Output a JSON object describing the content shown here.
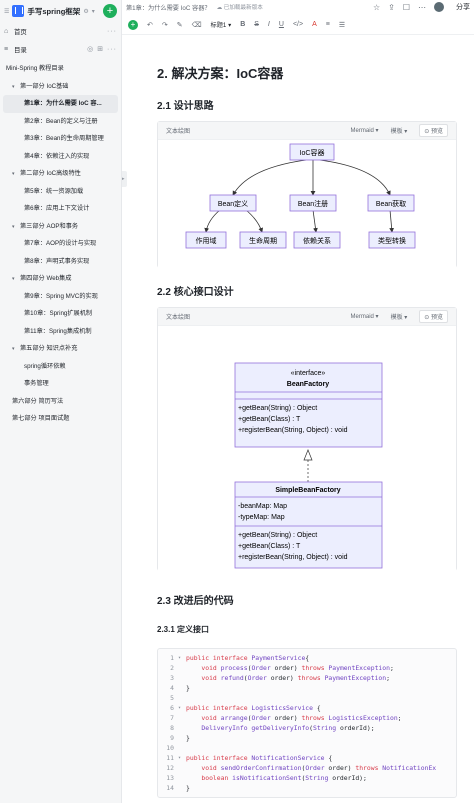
{
  "sidebar": {
    "book_title": "手写spring框架",
    "home_label": "首页",
    "toc_label": "目录",
    "tree": [
      {
        "label": "Mini-Spring 教程目录",
        "level": "l1"
      },
      {
        "label": "第一部分 IoC基础",
        "level": "l0",
        "arrow": true
      },
      {
        "label": "第1章：为什么需要 IoC 容...",
        "level": "l2",
        "active": true
      },
      {
        "label": "第2章：Bean的定义与注册",
        "level": "l2"
      },
      {
        "label": "第3章：Bean的生命周期管理",
        "level": "l2"
      },
      {
        "label": "第4章：依赖注入的实现",
        "level": "l2"
      },
      {
        "label": "第二部分 IoC高级特性",
        "level": "l0",
        "arrow": true
      },
      {
        "label": "第5章：统一资源加载",
        "level": "l2"
      },
      {
        "label": "第6章：应用上下文设计",
        "level": "l2"
      },
      {
        "label": "第三部分 AOP和事务",
        "level": "l0",
        "arrow": true
      },
      {
        "label": "第7章：AOP的设计与实现",
        "level": "l2"
      },
      {
        "label": "第8章：声明式事务实现",
        "level": "l2"
      },
      {
        "label": "第四部分 Web集成",
        "level": "l0",
        "arrow": true
      },
      {
        "label": "第9章：Spring MVC的实现",
        "level": "l2"
      },
      {
        "label": "第10章：Spring扩展机制",
        "level": "l2"
      },
      {
        "label": "第11章：Spring集成机制",
        "level": "l2"
      },
      {
        "label": "第五部分 知识点补充",
        "level": "l0",
        "arrow": true
      },
      {
        "label": "spring循环依赖",
        "level": "l2"
      },
      {
        "label": "事务管理",
        "level": "l2"
      },
      {
        "label": "第六部分 简历写法",
        "level": "l0"
      },
      {
        "label": "第七部分 项目面试题",
        "level": "l0"
      }
    ]
  },
  "header": {
    "breadcrumb": "第1章：为什么需要 IoC 容器？",
    "saved": "已加载最新版本",
    "share": "分享"
  },
  "toolbar": {
    "style": "标题1"
  },
  "doc": {
    "h2": "2. 解决方案：IoC容器",
    "h3_1": "2.1 设计思路",
    "h3_2": "2.2 核心接口设计",
    "h3_3": "2.3 改进后的代码",
    "h4_1": "2.3.1 定义接口"
  },
  "diagram_bar": {
    "title": "文本绘图",
    "engine": "Mermaid",
    "template": "模板",
    "preview": "预览"
  },
  "diagram1": {
    "root": "IoC容器",
    "mid": [
      "Bean定义",
      "Bean注册",
      "Bean获取"
    ],
    "leaf": [
      "作用域",
      "生命周期",
      "依赖关系",
      "类型转换"
    ]
  },
  "diagram2": {
    "iface_stereo": "«interface»",
    "iface_name": "BeanFactory",
    "iface_methods": [
      "+getBean(String) : Object",
      "+getBean(Class) : T",
      "+registerBean(String, Object) : void"
    ],
    "impl_name": "SimpleBeanFactory",
    "impl_fields": [
      "-beanMap: Map",
      "-typeMap: Map"
    ],
    "impl_methods": [
      "+getBean(String) : Object",
      "+getBean(Class) : T",
      "+registerBean(String, Object) : void"
    ]
  },
  "code": [
    {
      "n": "1",
      "t": true,
      "s": [
        [
          "kw",
          "public interface "
        ],
        [
          "ty",
          "PaymentService"
        ],
        [
          "",
          "{"
        ]
      ]
    },
    {
      "n": "2",
      "s": [
        [
          "",
          "    "
        ],
        [
          "kw",
          "void "
        ],
        [
          "ty",
          "process"
        ],
        [
          "",
          "("
        ],
        [
          "ty",
          "Order"
        ],
        [
          "",
          " order) "
        ],
        [
          "kw",
          "throws "
        ],
        [
          "ty",
          "PaymentException"
        ],
        [
          "",
          ";"
        ]
      ]
    },
    {
      "n": "3",
      "s": [
        [
          "",
          "    "
        ],
        [
          "kw",
          "void "
        ],
        [
          "ty",
          "refund"
        ],
        [
          "",
          "("
        ],
        [
          "ty",
          "Order"
        ],
        [
          "",
          " order) "
        ],
        [
          "kw",
          "throws "
        ],
        [
          "ty",
          "PaymentException"
        ],
        [
          "",
          ";"
        ]
      ]
    },
    {
      "n": "4",
      "s": [
        [
          "",
          "}"
        ]
      ]
    },
    {
      "n": "5",
      "s": []
    },
    {
      "n": "6",
      "t": true,
      "s": [
        [
          "kw",
          "public interface "
        ],
        [
          "ty",
          "LogisticsService"
        ],
        [
          "",
          " {"
        ]
      ]
    },
    {
      "n": "7",
      "s": [
        [
          "",
          "    "
        ],
        [
          "kw",
          "void "
        ],
        [
          "ty",
          "arrange"
        ],
        [
          "",
          "("
        ],
        [
          "ty",
          "Order"
        ],
        [
          "",
          " order) "
        ],
        [
          "kw",
          "throws "
        ],
        [
          "ty",
          "LogisticsException"
        ],
        [
          "",
          ";"
        ]
      ]
    },
    {
      "n": "8",
      "s": [
        [
          "",
          "    "
        ],
        [
          "ty",
          "DeliveryInfo"
        ],
        [
          "",
          " "
        ],
        [
          "ty",
          "getDeliveryInfo"
        ],
        [
          "",
          "("
        ],
        [
          "ty",
          "String"
        ],
        [
          "",
          " orderId);"
        ]
      ]
    },
    {
      "n": "9",
      "s": [
        [
          "",
          "}"
        ]
      ]
    },
    {
      "n": "10",
      "s": []
    },
    {
      "n": "11",
      "t": true,
      "s": [
        [
          "kw",
          "public interface "
        ],
        [
          "ty",
          "NotificationService"
        ],
        [
          "",
          " {"
        ]
      ]
    },
    {
      "n": "12",
      "s": [
        [
          "",
          "    "
        ],
        [
          "kw",
          "void "
        ],
        [
          "ty",
          "sendOrderConfirmation"
        ],
        [
          "",
          "("
        ],
        [
          "ty",
          "Order"
        ],
        [
          "",
          " order) "
        ],
        [
          "kw",
          "throws "
        ],
        [
          "ty",
          "NotificationEx"
        ]
      ]
    },
    {
      "n": "13",
      "s": [
        [
          "",
          "    "
        ],
        [
          "kw",
          "boolean "
        ],
        [
          "ty",
          "isNotificationSent"
        ],
        [
          "",
          "("
        ],
        [
          "ty",
          "String"
        ],
        [
          "",
          " orderId);"
        ]
      ]
    },
    {
      "n": "14",
      "s": [
        [
          "",
          "}"
        ]
      ]
    }
  ]
}
